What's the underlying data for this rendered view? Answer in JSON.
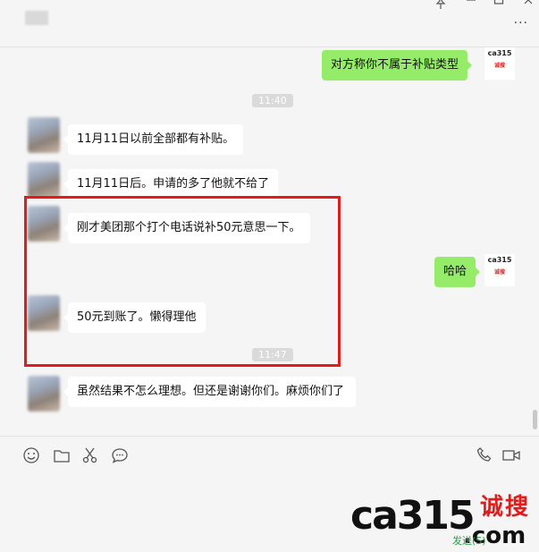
{
  "window": {
    "pin_icon": "pin-icon",
    "minimize_icon": "minimize-icon",
    "maximize_icon": "maximize-icon",
    "close_icon": "close-icon",
    "more_label": "···"
  },
  "messages": [
    {
      "side": "out",
      "text": "对方称你不属于补贴类型"
    },
    {
      "side": "in",
      "text": "11月11日以前全部都有补贴。"
    },
    {
      "side": "in",
      "text": "11月11日后。申请的多了他就不给了"
    },
    {
      "side": "in",
      "text": "刚才美团那个打个电话说补50元意思一下。"
    },
    {
      "side": "out",
      "text": "哈哈"
    },
    {
      "side": "in",
      "text": "50元到账了。懒得理他"
    },
    {
      "side": "in",
      "text": "虽然结果不怎么理想。但还是谢谢你们。麻烦你们了"
    }
  ],
  "timestamps": [
    "11:40",
    "11:47"
  ],
  "my_avatar": {
    "text": "ca315",
    "sub": "诚搜"
  },
  "toolbar": {
    "icons": [
      "emoji-icon",
      "folder-icon",
      "scissors-icon",
      "chat-history-icon"
    ],
    "right_icons": [
      "phone-icon",
      "video-call-icon"
    ]
  },
  "watermark": {
    "brand": "ca315",
    "cn": "诚搜",
    "com": ".com"
  },
  "send_button": "发送(S)",
  "colors": {
    "outgoing_bubble": "#95ec69",
    "incoming_bubble": "#ffffff",
    "highlight_box": "#e51b1b"
  }
}
